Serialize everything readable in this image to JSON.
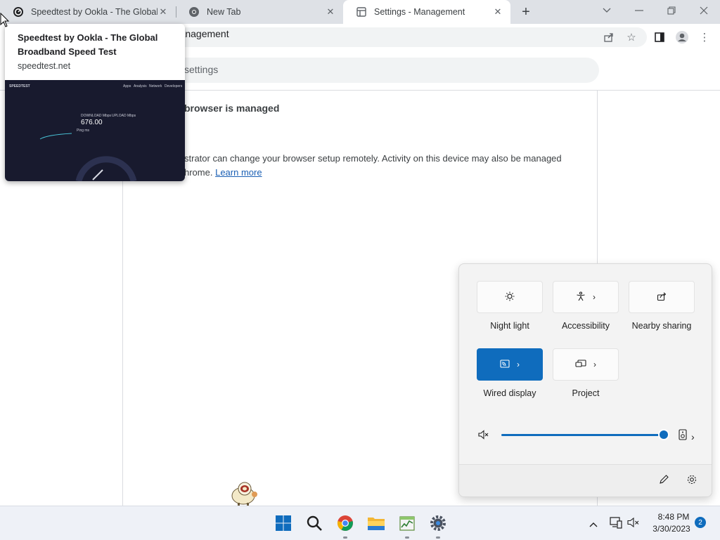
{
  "tabs": [
    {
      "title": "Speedtest by Ookla - The Global",
      "icon": "speedtest-icon"
    },
    {
      "title": "New Tab",
      "icon": "chrome-icon"
    },
    {
      "title": "Settings - Management",
      "icon": "settings-icon"
    }
  ],
  "toolbar": {
    "url": "/management"
  },
  "settings": {
    "search_placeholder": "settings",
    "managed_title": "browser is managed",
    "managed_text1": "strator can change your browser setup remotely. Activity on this device may also be managed",
    "managed_text2_prefix": "hrome.",
    "learn_more": "Learn more"
  },
  "hovercard": {
    "title": "Speedtest by Ookla - The Global Broadband Speed Test",
    "domain": "speedtest.net",
    "thumb": {
      "brand": "SPEEDTEST",
      "nav": [
        "Apps",
        "Analysis",
        "Network",
        "Developers"
      ],
      "download_label": "DOWNLOAD Mbps",
      "upload_label": "UPLOAD Mbps",
      "value": "676.00",
      "ping_label": "Ping ms"
    }
  },
  "quick_settings": {
    "tiles": [
      {
        "label": "Night light",
        "icon": "night-light-icon",
        "active": false,
        "has_chevron": false
      },
      {
        "label": "Accessibility",
        "icon": "accessibility-icon",
        "active": false,
        "has_chevron": true
      },
      {
        "label": "Nearby sharing",
        "icon": "nearby-sharing-icon",
        "active": false,
        "has_chevron": false
      },
      {
        "label": "Wired display",
        "icon": "cast-icon",
        "active": true,
        "has_chevron": true
      },
      {
        "label": "Project",
        "icon": "project-icon",
        "active": false,
        "has_chevron": true
      }
    ],
    "volume_level": 1.0,
    "accent_color": "#0f6cbd"
  },
  "taskbar": {
    "time": "8:48 PM",
    "date": "3/30/2023",
    "notifications": "2"
  }
}
